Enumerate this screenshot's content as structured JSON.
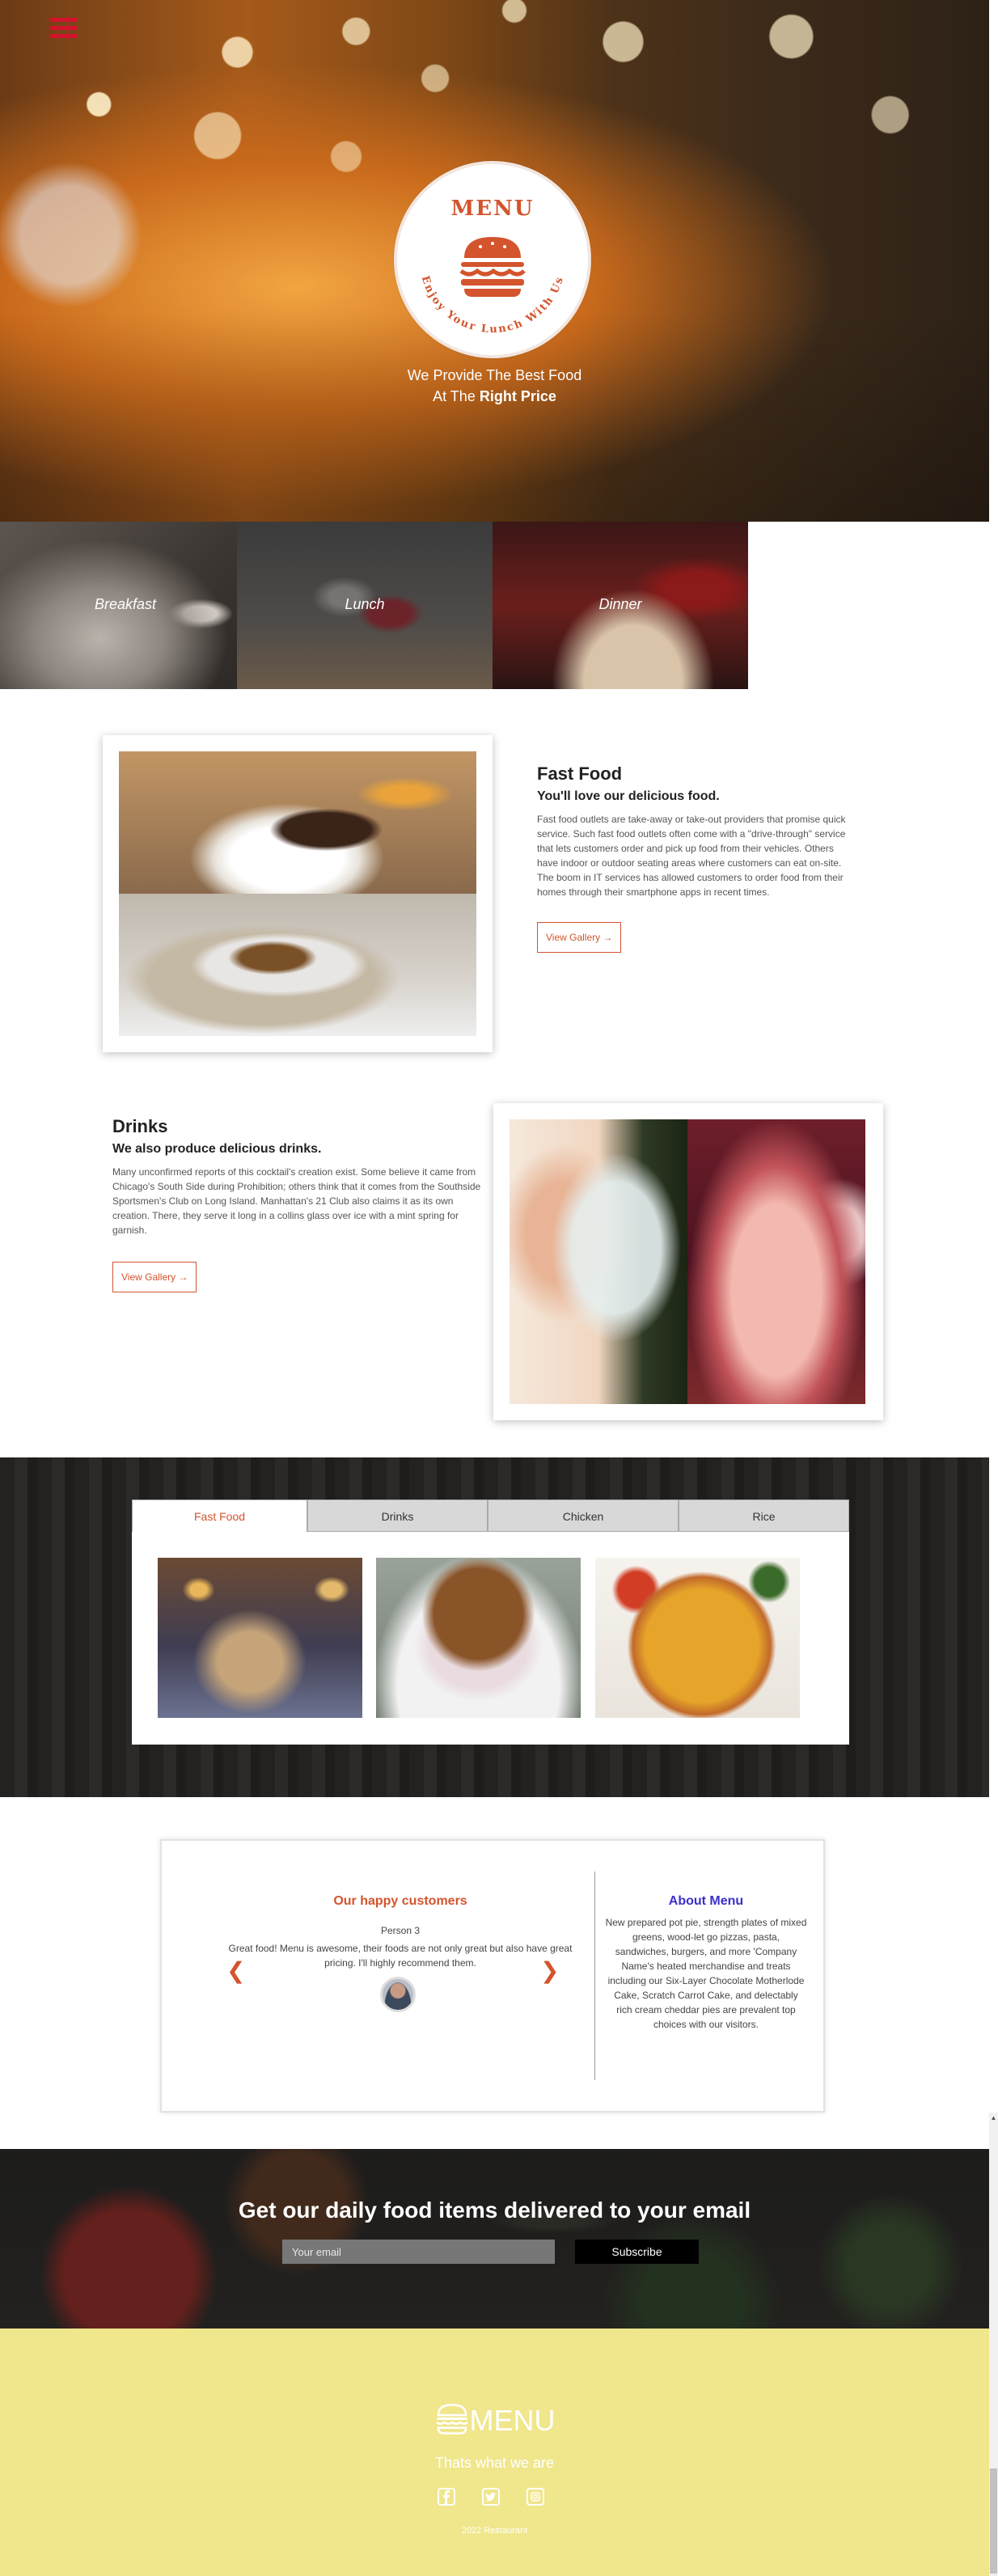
{
  "header": {
    "menu_icon": "hamburger-icon"
  },
  "hero": {
    "logo_title": "MENU",
    "logo_ring_text": "Enjoy Your Lunch With Us",
    "logo_icon": "burger-icon",
    "tagline_line1": "We Provide The Best Food",
    "tagline_line2_prefix": "At The",
    "tagline_line2_bold": "Right Price"
  },
  "meal_tiles": [
    {
      "label": "Breakfast"
    },
    {
      "label": "Lunch"
    },
    {
      "label": "Dinner"
    }
  ],
  "fast_food": {
    "title": "Fast Food",
    "subtitle": "You'll love our delicious food.",
    "text": "Fast food outlets are take-away or take-out providers that promise quick service. Such fast food outlets often come with a \"drive-through\" service that lets customers order and pick up food from their vehicles. Others have indoor or outdoor seating areas where customers can eat on-site. The boom in IT services has allowed customers to order food from their homes through their smartphone apps in recent times.",
    "button": "View Gallery →"
  },
  "drinks": {
    "title": "Drinks",
    "subtitle": "We also produce delicious drinks.",
    "text": "Many unconfirmed reports of this cocktail's creation exist. Some believe it came from Chicago's South Side during Prohibition; others think that it comes from the Southside Sportsmen's Club on Long Island. Manhattan's 21 Club also claims it as its own creation. There, they serve it long in a collins glass over ice with a mint spring for garnish.",
    "button": "View Gallery →"
  },
  "menu_tabs": {
    "tabs": [
      "Fast Food",
      "Drinks",
      "Chicken",
      "Rice"
    ],
    "active": "Fast Food"
  },
  "customers": {
    "title": "Our happy customers",
    "person": "Person 3",
    "quote": "Great food! Menu is awesome, their foods are not only great but also have great pricing. I'll highly recommend them.",
    "prev_icon": "chevron-left-icon",
    "next_icon": "chevron-right-icon"
  },
  "about": {
    "title": "About Menu",
    "text": "New prepared pot pie, strength plates of mixed greens, wood-let go pizzas, pasta, sandwiches, burgers, and more 'Company Name's heated merchandise and treats including our Six-Layer Chocolate Motherlode Cake, Scratch Carrot Cake, and delectably rich cream cheddar pies are prevalent top choices with our visitors."
  },
  "newsletter": {
    "title": "Get our daily food items delivered to your email",
    "placeholder": "Your email",
    "button": "Subscribe"
  },
  "footer": {
    "logo_text": "MENU",
    "tagline": "Thats what we are",
    "social_icons": [
      "facebook-icon",
      "twitter-icon",
      "instagram-icon"
    ],
    "copyright": "2022 Restaurant"
  },
  "colors": {
    "accent": "#d3542d",
    "hamburger": "#d2132c",
    "about_title": "#3c2fc9",
    "footer_bg": "#f0e68c"
  }
}
